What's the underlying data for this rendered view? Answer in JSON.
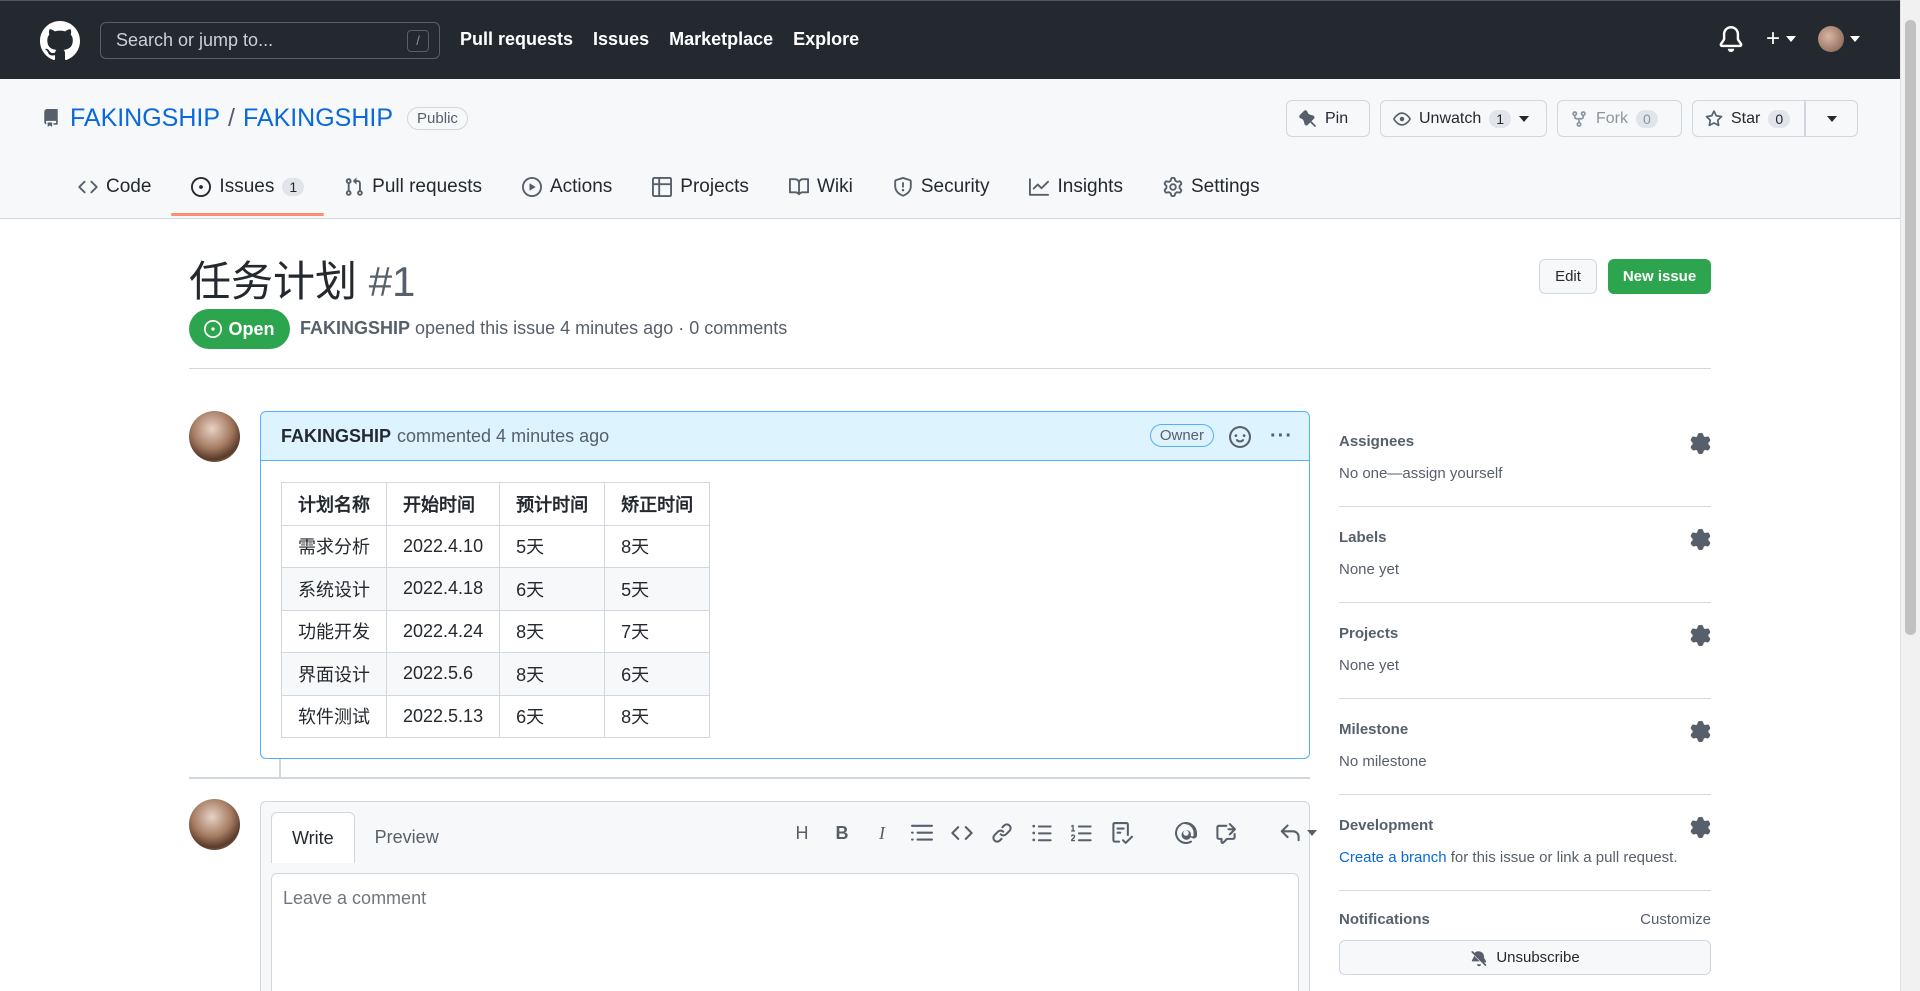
{
  "topbar": {
    "search_placeholder": "Search or jump to...",
    "search_shortcut": "/",
    "nav": [
      "Pull requests",
      "Issues",
      "Marketplace",
      "Explore"
    ]
  },
  "repo": {
    "owner": "FAKINGSHIP",
    "separator": "/",
    "name": "FAKINGSHIP",
    "visibility": "Public",
    "pin_label": "Pin",
    "unwatch_label": "Unwatch",
    "unwatch_count": "1",
    "fork_label": "Fork",
    "fork_count": "0",
    "star_label": "Star",
    "star_count": "0"
  },
  "tabs": [
    {
      "label": "Code",
      "icon": "code-icon"
    },
    {
      "label": "Issues",
      "icon": "issue-opened-icon",
      "count": "1",
      "selected": true
    },
    {
      "label": "Pull requests",
      "icon": "git-pull-request-icon"
    },
    {
      "label": "Actions",
      "icon": "play-icon"
    },
    {
      "label": "Projects",
      "icon": "table-icon"
    },
    {
      "label": "Wiki",
      "icon": "book-icon"
    },
    {
      "label": "Security",
      "icon": "shield-icon"
    },
    {
      "label": "Insights",
      "icon": "graph-icon"
    },
    {
      "label": "Settings",
      "icon": "gear-icon"
    }
  ],
  "issue": {
    "title": "任务计划",
    "number": "#1",
    "edit_label": "Edit",
    "new_issue_label": "New issue",
    "state": "Open",
    "author": "FAKINGSHIP",
    "meta_text": "opened this issue 4 minutes ago · 0 comments"
  },
  "comment": {
    "author": "FAKINGSHIP",
    "action": "commented 4 minutes ago",
    "role": "Owner",
    "table": {
      "headers": [
        "计划名称",
        "开始时间",
        "预计时间",
        "矫正时间"
      ],
      "rows": [
        [
          "需求分析",
          "2022.4.10",
          "5天",
          "8天"
        ],
        [
          "系统设计",
          "2022.4.18",
          "6天",
          "5天"
        ],
        [
          "功能开发",
          "2022.4.24",
          "8天",
          "7天"
        ],
        [
          "界面设计",
          "2022.5.6",
          "8天",
          "6天"
        ],
        [
          "软件测试",
          "2022.5.13",
          "6天",
          "8天"
        ]
      ]
    }
  },
  "editor": {
    "write_tab": "Write",
    "preview_tab": "Preview",
    "placeholder": "Leave a comment",
    "toolbar": [
      "H",
      "B",
      "I"
    ]
  },
  "sidebar": {
    "assignees_title": "Assignees",
    "assignees_value": "No one—assign yourself",
    "labels_title": "Labels",
    "labels_value": "None yet",
    "projects_title": "Projects",
    "projects_value": "None yet",
    "milestone_title": "Milestone",
    "milestone_value": "No milestone",
    "development_title": "Development",
    "development_link": "Create a branch",
    "development_rest": " for this issue or link a pull request.",
    "notifications_title": "Notifications",
    "customize_label": "Customize",
    "unsubscribe_label": "Unsubscribe"
  },
  "colors": {
    "header_bg": "#24292f",
    "link": "#0969da",
    "green": "#2da44e",
    "tab_underline": "#fd8c73",
    "comment_border": "#54aeff",
    "comment_head_bg": "#ddf4ff"
  }
}
